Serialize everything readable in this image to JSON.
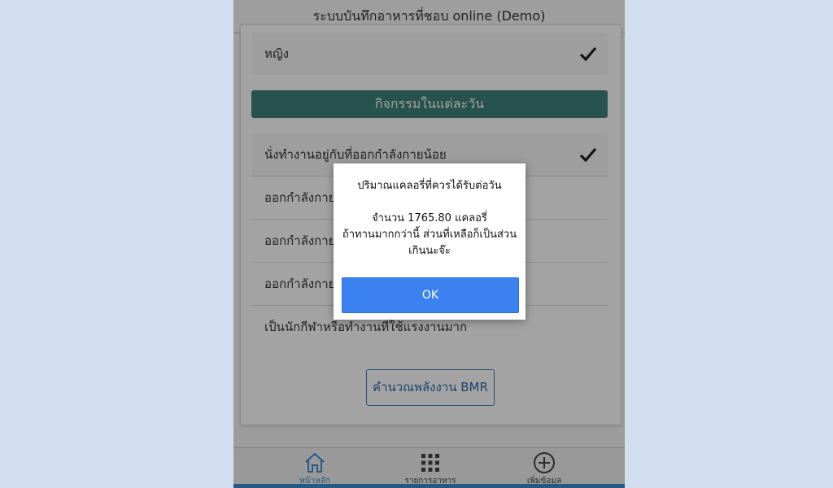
{
  "header": {
    "title": "ระบบบันทึกอาหารที่ชอบ online (Demo)"
  },
  "gender": {
    "label": "หญิง",
    "selected": true
  },
  "activity_section": {
    "title": "กิจกรรมในแต่ละวัน"
  },
  "activities": [
    {
      "label": "นั่งทำงานอยู่กับที่ออกกำลังกายน้อย",
      "selected": true
    },
    {
      "label": "ออกกำลังกายหรือเล่นกีฬาเล็กน้อย",
      "selected": false
    },
    {
      "label": "ออกกำลังกายหรือเล่นกีฬาปานกลาง",
      "selected": false
    },
    {
      "label": "ออกกำลังกายหรือเล่นกีฬาอย่างหนัก",
      "selected": false
    },
    {
      "label": "เป็นนักกีฬาหรือทำงานที่ใช้แรงงานมาก",
      "selected": false
    }
  ],
  "bmr_button": {
    "label": "คำนวณพลังงาน BMR"
  },
  "footer": {
    "items": [
      {
        "label": "หน้าหลัก",
        "icon": "home-icon",
        "active": true
      },
      {
        "label": "รายการอาหาร",
        "icon": "grid-icon",
        "active": false
      },
      {
        "label": "เพิ่มข้อมูล",
        "icon": "add-circle-icon",
        "active": false
      }
    ]
  },
  "dialog": {
    "title": "ปริมาณแคลอรี่ที่ควรได้รับต่อวัน",
    "line1": "จำนวน 1765.80 แคลอรี่",
    "line2": "ถ้าทานมากกว่านี้ ส่วนที่เหลือก็เป็นส่วน",
    "line3": "เกินนะจ๊ะ",
    "ok_label": "OK"
  },
  "colors": {
    "section_bar": "#3d807a",
    "ok_button": "#3b82f0",
    "active_nav": "#3c8ccf",
    "page_background": "#d2ddef"
  }
}
